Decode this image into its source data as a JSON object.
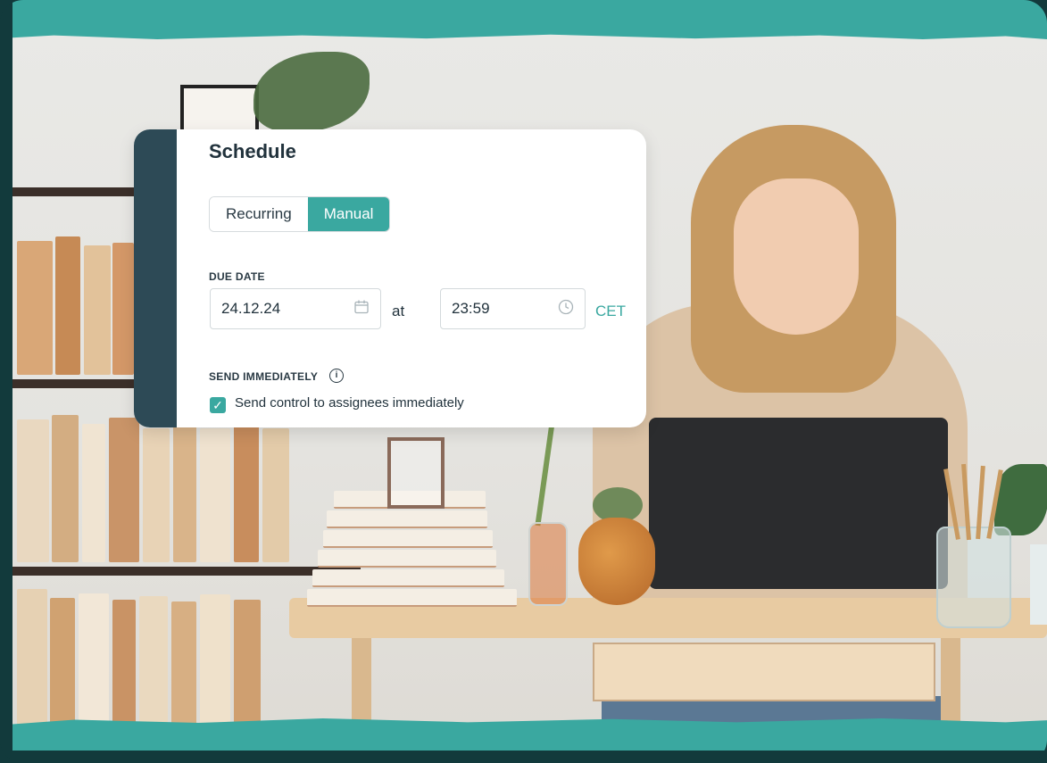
{
  "schedule": {
    "title": "Schedule",
    "mode_options": [
      "Recurring",
      "Manual"
    ],
    "selected_mode": "Manual",
    "due_date_label": "DUE DATE",
    "date_value": "24.12.24",
    "at_label": "at",
    "time_value": "23:59",
    "timezone": "CET",
    "send_immediately_label": "SEND IMMEDIATELY",
    "send_checkbox_label": "Send control to assignees immediately",
    "send_checked": true
  },
  "icons": {
    "calendar": "calendar-icon",
    "clock": "clock-icon",
    "info": "info-icon",
    "check": "checkmark-icon"
  },
  "colors": {
    "accent": "#3aa8a0",
    "frame_dark": "#123a3c",
    "card_stripe": "#2d4a56"
  }
}
